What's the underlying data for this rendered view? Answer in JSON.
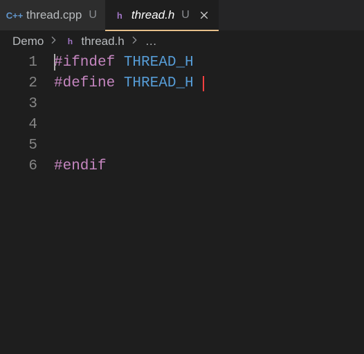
{
  "tabs": [
    {
      "icon_label": "C++",
      "icon_color": "#6196cc",
      "name": "thread.cpp",
      "status": "U"
    },
    {
      "icon_label": "h",
      "icon_color": "#a074c4",
      "name": "thread.h",
      "status": "U"
    }
  ],
  "breadcrumbs": {
    "root": "Demo",
    "file_icon_label": "h",
    "file_icon_color": "#a074c4",
    "file": "thread.h",
    "dots": "…"
  },
  "code": {
    "lineNumbers": [
      "1",
      "2",
      "3",
      "4",
      "5",
      "6"
    ],
    "lines": [
      {
        "directive": "#ifndef",
        "macro": "THREAD_H"
      },
      {
        "directive": "#define",
        "macro": "THREAD_H"
      },
      null,
      null,
      null,
      {
        "directive": "#endif",
        "macro": ""
      }
    ]
  }
}
